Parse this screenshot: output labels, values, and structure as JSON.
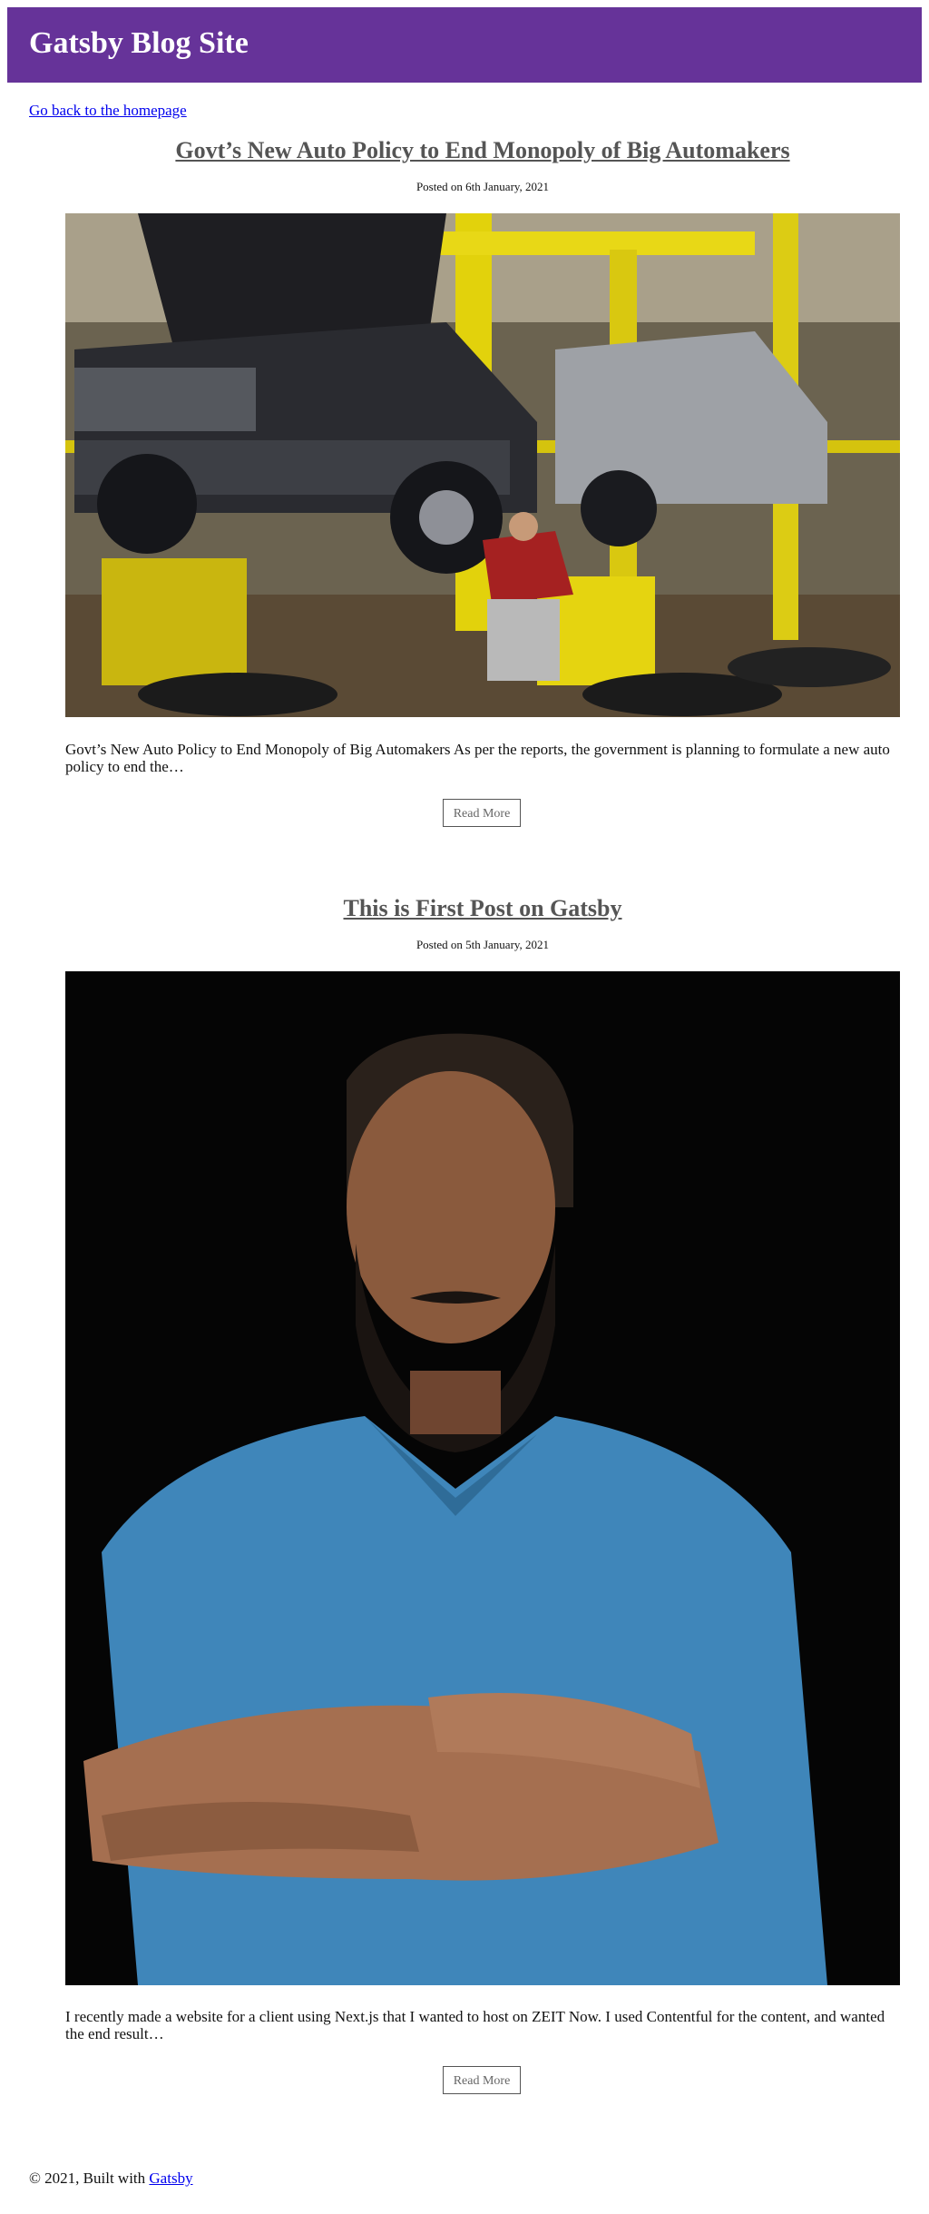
{
  "header": {
    "title": "Gatsby Blog Site",
    "color": "#663399"
  },
  "nav": {
    "back_label": "Go back to the homepage"
  },
  "posts": [
    {
      "title": "Govt’s New Auto Policy to End Monopoly of Big Automakers",
      "date": "Posted on 6th January, 2021",
      "excerpt": "Govt’s New Auto Policy to End Monopoly of Big Automakers As per the reports, the government is planning to formulate a new auto policy to end the…",
      "read_more_label": "Read More"
    },
    {
      "title": "This is First Post on Gatsby",
      "date": "Posted on 5th January, 2021",
      "excerpt": "I recently made a website for a client using Next.js that I wanted to host on ZEIT Now. I used Contentful for the content, and wanted the end result…",
      "read_more_label": "Read More"
    }
  ],
  "footer": {
    "text": "© 2021, Built with",
    "link_label": "Gatsby"
  }
}
